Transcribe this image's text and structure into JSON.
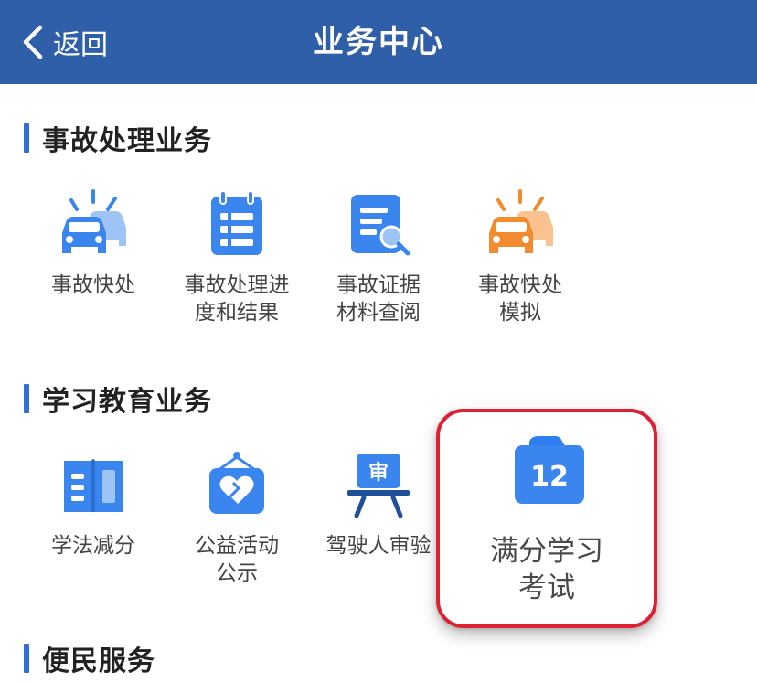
{
  "header": {
    "back_label": "返回",
    "title": "业务中心",
    "background": "#2f5fa8"
  },
  "sections": [
    {
      "title": "事故处理业务",
      "items": [
        {
          "label": "事故快处",
          "icon": "two-cars-icon"
        },
        {
          "label": "事故处理进\n度和结果",
          "icon": "calendar-list-icon"
        },
        {
          "label": "事故证据\n材料查阅",
          "icon": "document-search-icon"
        },
        {
          "label": "事故快处\n模拟",
          "icon": "orange-cars-icon"
        }
      ]
    },
    {
      "title": "学习教育业务",
      "items": [
        {
          "label": "学法减分",
          "icon": "open-book-icon"
        },
        {
          "label": "公益活动\n公示",
          "icon": "heart-sign-icon"
        },
        {
          "label": "驾驶人审验",
          "icon": "review-board-icon"
        }
      ],
      "highlighted_item": {
        "label": "满分学习\n考试",
        "icon": "score-12-folder-icon",
        "badge": "12"
      }
    },
    {
      "title": "便民服务"
    }
  ],
  "review_board_text": "审",
  "colors": {
    "accent_blue": "#2f6fd6",
    "icon_blue": "#3a86ee",
    "icon_orange": "#f28a2e",
    "highlight_border": "#dc2232"
  }
}
